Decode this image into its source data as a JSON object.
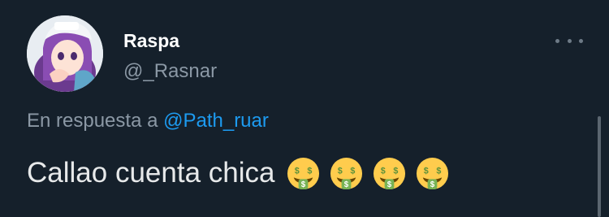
{
  "user": {
    "display_name": "Raspa",
    "handle": "@_Rasnar",
    "avatar_icon": "avatar-icon"
  },
  "reply": {
    "prefix": "En respuesta a",
    "mention": "@Path_ruar"
  },
  "tweet": {
    "text": "Callao cuenta chica",
    "emojis": [
      "money-mouth-face-emoji",
      "money-mouth-face-emoji",
      "money-mouth-face-emoji",
      "money-mouth-face-emoji"
    ]
  },
  "menu": {
    "icon": "more-options-icon"
  },
  "colors": {
    "background": "#15202b",
    "text_primary": "#e7e9ea",
    "text_secondary": "#8b98a5",
    "link": "#1d9bf0"
  }
}
